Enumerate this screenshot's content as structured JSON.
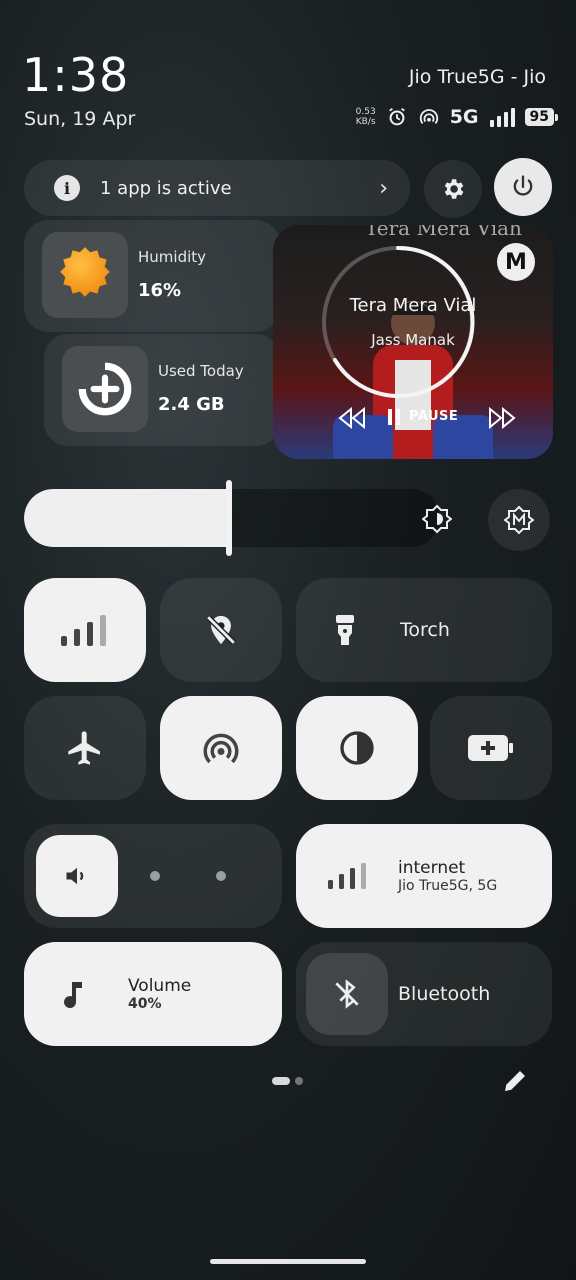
{
  "status": {
    "time": "1:38",
    "date": "Sun, 19 Apr",
    "carrier": "Jio True5G - Jio",
    "speed_value": "0.53",
    "speed_unit": "KB/s",
    "network": "5G",
    "battery": "95"
  },
  "active_apps": {
    "label": "1 app is active"
  },
  "widgets": {
    "humidity": {
      "label": "Humidity",
      "value": "16%"
    },
    "data": {
      "label": "Used Today",
      "value": "2.4 GB"
    }
  },
  "media": {
    "art_text": "Tera Mera Viah",
    "song": "Tera Mera Vial",
    "artist": "Jass Manak",
    "pause_label": "PAUSE",
    "app_badge": "M"
  },
  "brightness": {
    "level": 0.5
  },
  "tiles": {
    "torch": "Torch",
    "internet": {
      "label": "internet",
      "sub": "Jio True5G, 5G"
    },
    "volume": {
      "label": "Volume",
      "sub": "40%"
    },
    "bluetooth": "Bluetooth"
  },
  "pager": {
    "page": 1,
    "pages": 2
  },
  "colors": {
    "accent": "#f1f1f1",
    "tile_off": "#2a2f31",
    "sun": "#f5a623"
  }
}
